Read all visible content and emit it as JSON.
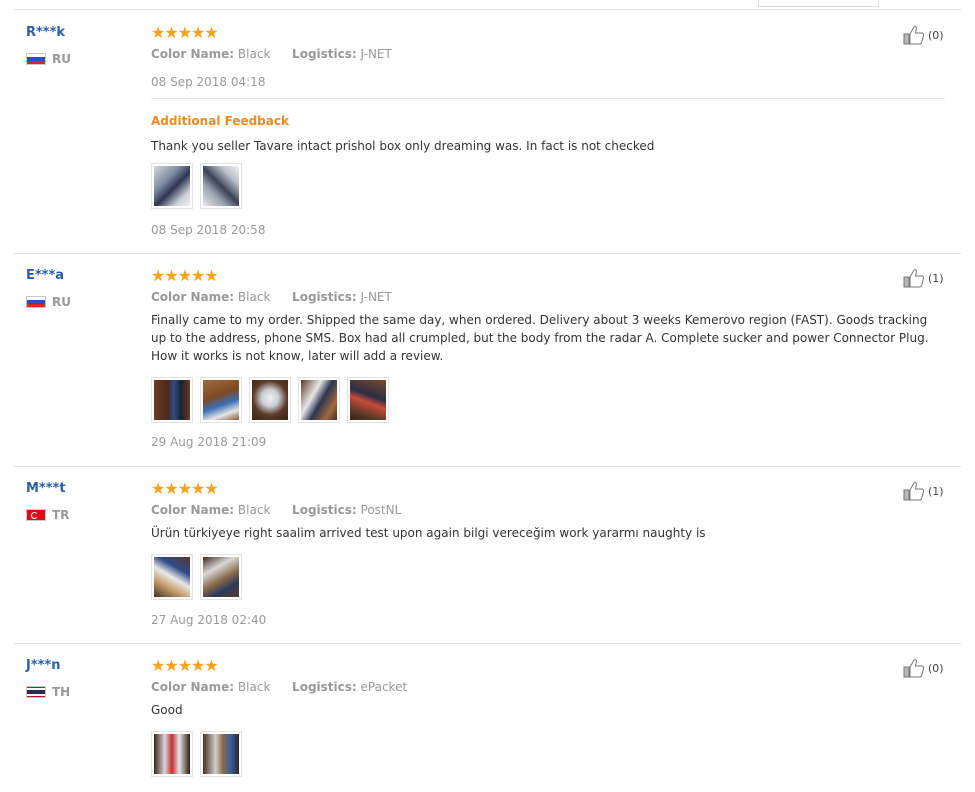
{
  "reviews": [
    {
      "user": "R***k",
      "country": "RU",
      "stars": "★★★★★",
      "color_label": "Color Name:",
      "color_value": "Black",
      "logistics_label": "Logistics:",
      "logistics_value": "J-NET",
      "feedback": "",
      "date": "08 Sep 2018 04:18",
      "likes": "(0)",
      "additional": {
        "title": "Additional Feedback",
        "text": "Thank you seller Tavare intact prishol box only dreaming was. In fact is not checked",
        "date": "08 Sep 2018 20:58"
      }
    },
    {
      "user": "E***a",
      "country": "RU",
      "stars": "★★★★★",
      "color_label": "Color Name:",
      "color_value": "Black",
      "logistics_label": "Logistics:",
      "logistics_value": "J-NET",
      "feedback": "Finally came to my order. Shipped the same day, when ordered. Delivery about 3 weeks Kemerovo region (FAST). Goods tracking up to the address, phone SMS. Box had all crumpled, but the body from the radar A. Complete sucker and power Connector Plug. How it works is not know, later will add a review.",
      "date": "29 Aug 2018 21:09",
      "likes": "(1)"
    },
    {
      "user": "M***t",
      "country": "TR",
      "stars": "★★★★★",
      "color_label": "Color Name:",
      "color_value": "Black",
      "logistics_label": "Logistics:",
      "logistics_value": "PostNL",
      "feedback": "Ürün türkiyeye right saalim arrived test upon again bilgi vereceğim work yararmı naughty is",
      "date": "27 Aug 2018 02:40",
      "likes": "(1)"
    },
    {
      "user": "J***n",
      "country": "TH",
      "stars": "★★★★★",
      "color_label": "Color Name:",
      "color_value": "Black",
      "logistics_label": "Logistics:",
      "logistics_value": "ePacket",
      "feedback": "Good",
      "likes": "(0)"
    }
  ]
}
